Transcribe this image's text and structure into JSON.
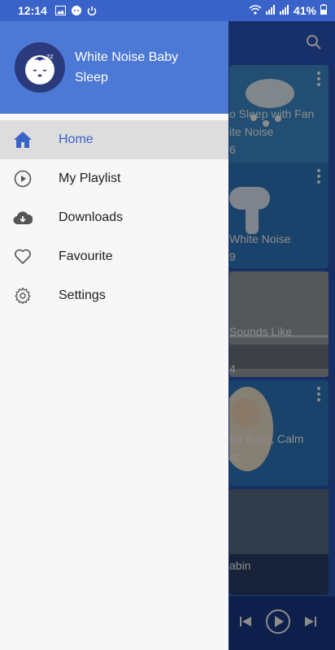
{
  "status_bar": {
    "time": "12:14",
    "battery": "41%"
  },
  "drawer": {
    "app_name": "White Noise Baby Sleep",
    "accent_color": "#3a63c9",
    "header_color": "#4c78d6",
    "menu": [
      {
        "label": "Home",
        "icon": "home-icon",
        "active": true
      },
      {
        "label": "My Playlist",
        "icon": "play-circle-icon",
        "active": false
      },
      {
        "label": "Downloads",
        "icon": "cloud-download-icon",
        "active": false
      },
      {
        "label": "Favourite",
        "icon": "heart-icon",
        "active": false
      },
      {
        "label": "Settings",
        "icon": "gear-icon",
        "active": false
      }
    ]
  },
  "background": {
    "cards": [
      {
        "line1": "o Sleep with Fan",
        "line2": "ite Noise",
        "line3": "6"
      },
      {
        "line1": "",
        "line2": "White Noise",
        "line3": "9"
      },
      {
        "line1": "",
        "line2": "Sounds Like",
        "line3": "4"
      },
      {
        "line1": "",
        "line2": "for Baby, Calm",
        "line3": "nt"
      },
      {
        "line1": "",
        "line2": "abin",
        "line3": ""
      }
    ]
  }
}
